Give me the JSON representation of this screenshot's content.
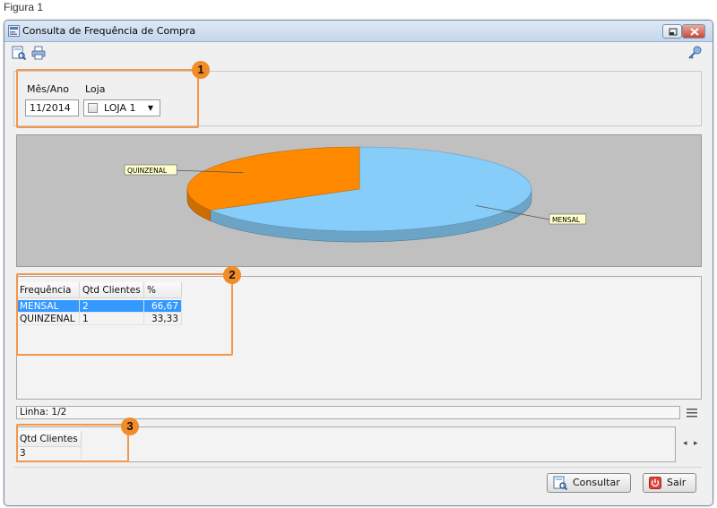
{
  "figure_caption": "Figura 1",
  "window": {
    "title": "Consulta de Frequência de Compra"
  },
  "filters": {
    "mes_ano_label": "Mês/Ano",
    "mes_ano_value": "11/2014",
    "loja_label": "Loja",
    "loja_value": "LOJA 1"
  },
  "chart_data": {
    "type": "pie",
    "categories": [
      "MENSAL",
      "QUINZENAL"
    ],
    "values": [
      66.67,
      33.33
    ],
    "colors": [
      "#87cdfa",
      "#ff8a00"
    ],
    "style": "3d",
    "background": "#c0c0c0"
  },
  "table": {
    "headers": [
      "Frequência",
      "Qtd Clientes",
      "%"
    ],
    "rows": [
      {
        "freq": "MENSAL",
        "qtd": "2",
        "pct": "66,67",
        "selected": true
      },
      {
        "freq": "QUINZENAL",
        "qtd": "1",
        "pct": "33,33",
        "selected": false
      }
    ]
  },
  "status": {
    "linha": "Linha: 1/2"
  },
  "summary": {
    "header": "Qtd Clientes",
    "value": "3"
  },
  "buttons": {
    "consultar": "Consultar",
    "sair": "Sair"
  },
  "annotations": [
    "1",
    "2",
    "3"
  ],
  "colors": {
    "annotation_orange": "#f28c28",
    "selection_blue": "#3399ff"
  },
  "icons": [
    "window-app-icon",
    "search-doc-icon",
    "print-icon",
    "key-icon",
    "menu-lines-icon",
    "scroll-left-icon",
    "scroll-right-icon",
    "consultar-icon",
    "sair-power-icon"
  ]
}
